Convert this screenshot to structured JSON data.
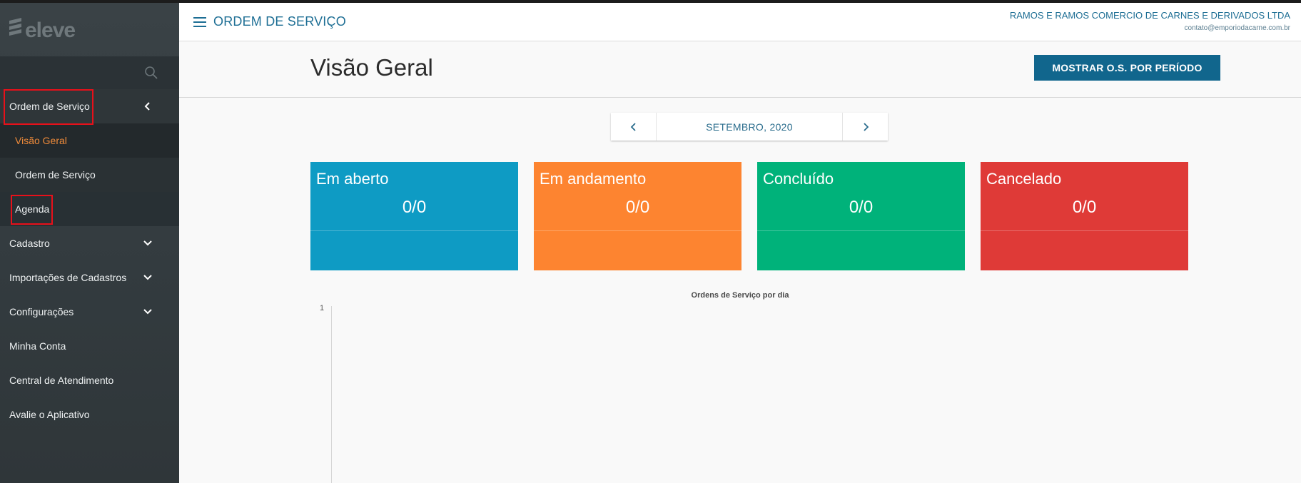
{
  "brand": {
    "logo_text": "eleve"
  },
  "sidebar": {
    "search_icon": "search-icon",
    "items": [
      {
        "label": "Ordem de Serviço",
        "icon": "chevron-left-icon",
        "highlighted": true
      },
      {
        "label": "Visão Geral",
        "active": true
      },
      {
        "label": "Ordem de Serviço"
      },
      {
        "label": "Agenda",
        "highlighted": true
      },
      {
        "label": "Cadastro",
        "icon": "chevron-down-icon"
      },
      {
        "label": "Importações de Cadastros",
        "icon": "chevron-down-icon"
      },
      {
        "label": "Configurações",
        "icon": "chevron-down-icon"
      },
      {
        "label": "Minha Conta"
      },
      {
        "label": "Central de Atendimento"
      },
      {
        "label": "Avalie o Aplicativo"
      }
    ]
  },
  "header": {
    "menu_icon": "hamburger-icon",
    "title": "ORDEM DE SERVIÇO",
    "company_name": "RAMOS E RAMOS COMERCIO DE CARNES E DERIVADOS LTDA",
    "company_email": "contato@emporiodacarne.com.br"
  },
  "page": {
    "title": "Visão Geral",
    "period_button": "MOSTRAR O.S. POR PERÍODO"
  },
  "month_nav": {
    "label": "SETEMBRO, 2020"
  },
  "cards": [
    {
      "title": "Em aberto",
      "value": "0/0",
      "color": "#0e9bc4"
    },
    {
      "title": "Em andamento",
      "value": "0/0",
      "color": "#fd8430"
    },
    {
      "title": "Concluído",
      "value": "0/0",
      "color": "#00b27a"
    },
    {
      "title": "Cancelado",
      "value": "0/0",
      "color": "#df3a37"
    }
  ],
  "chart": {
    "title": "Ordens de Serviço por dia",
    "y_tick": "1"
  },
  "colors": {
    "accent": "#1d6e94",
    "active_menu": "#f08b3a",
    "highlight_box": "#e8101a"
  }
}
